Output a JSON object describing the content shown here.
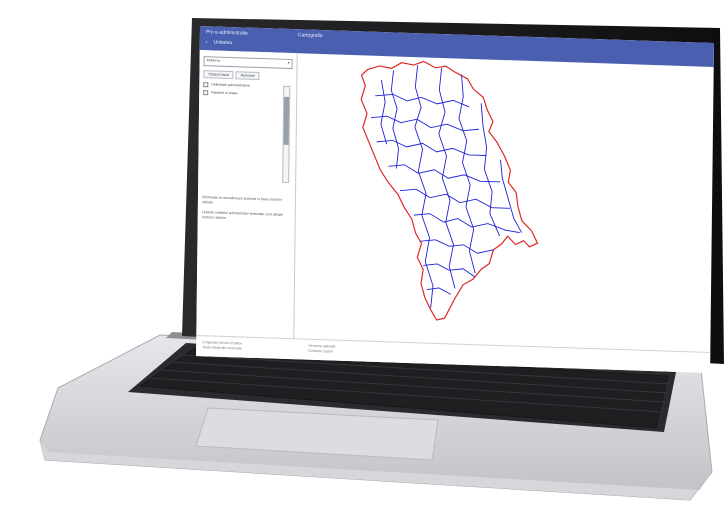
{
  "scene": {
    "colors": {
      "header": "#4a5fb0",
      "country_border": "#e02828",
      "district_lines": "#1e22d8",
      "laptop_body": "#cfd1d6",
      "keys": "#1c1c1e"
    }
  },
  "screen": {
    "header": {
      "app_title": "Pro e-administratie",
      "subnav_label": "Unitatea",
      "main_title": "Cartografie",
      "chevron_icon": "chevron-left-icon"
    },
    "sidebar": {
      "select_value": "Moldova",
      "select_icon": "chevron-down-icon",
      "tabs": [
        "Straturi harta",
        "Raionare"
      ],
      "layers": [
        "Delimitare administrativa",
        "Raioane si orase"
      ],
      "info_paragraphs": [
        "Informatia se actualizeaza automat in baza surselor oficiale.",
        "Limitele unitatilor administrativ-teritoriale sunt afisate conform datelor"
      ]
    },
    "map": {
      "subject": "Moldova districts map"
    },
    "footer": {
      "left_lines": [
        "© Agentia Servicii Publice",
        "Toate drepturile rezervate"
      ],
      "right_lines": [
        "Versiune aplicatie",
        "Contacte suport"
      ]
    }
  }
}
